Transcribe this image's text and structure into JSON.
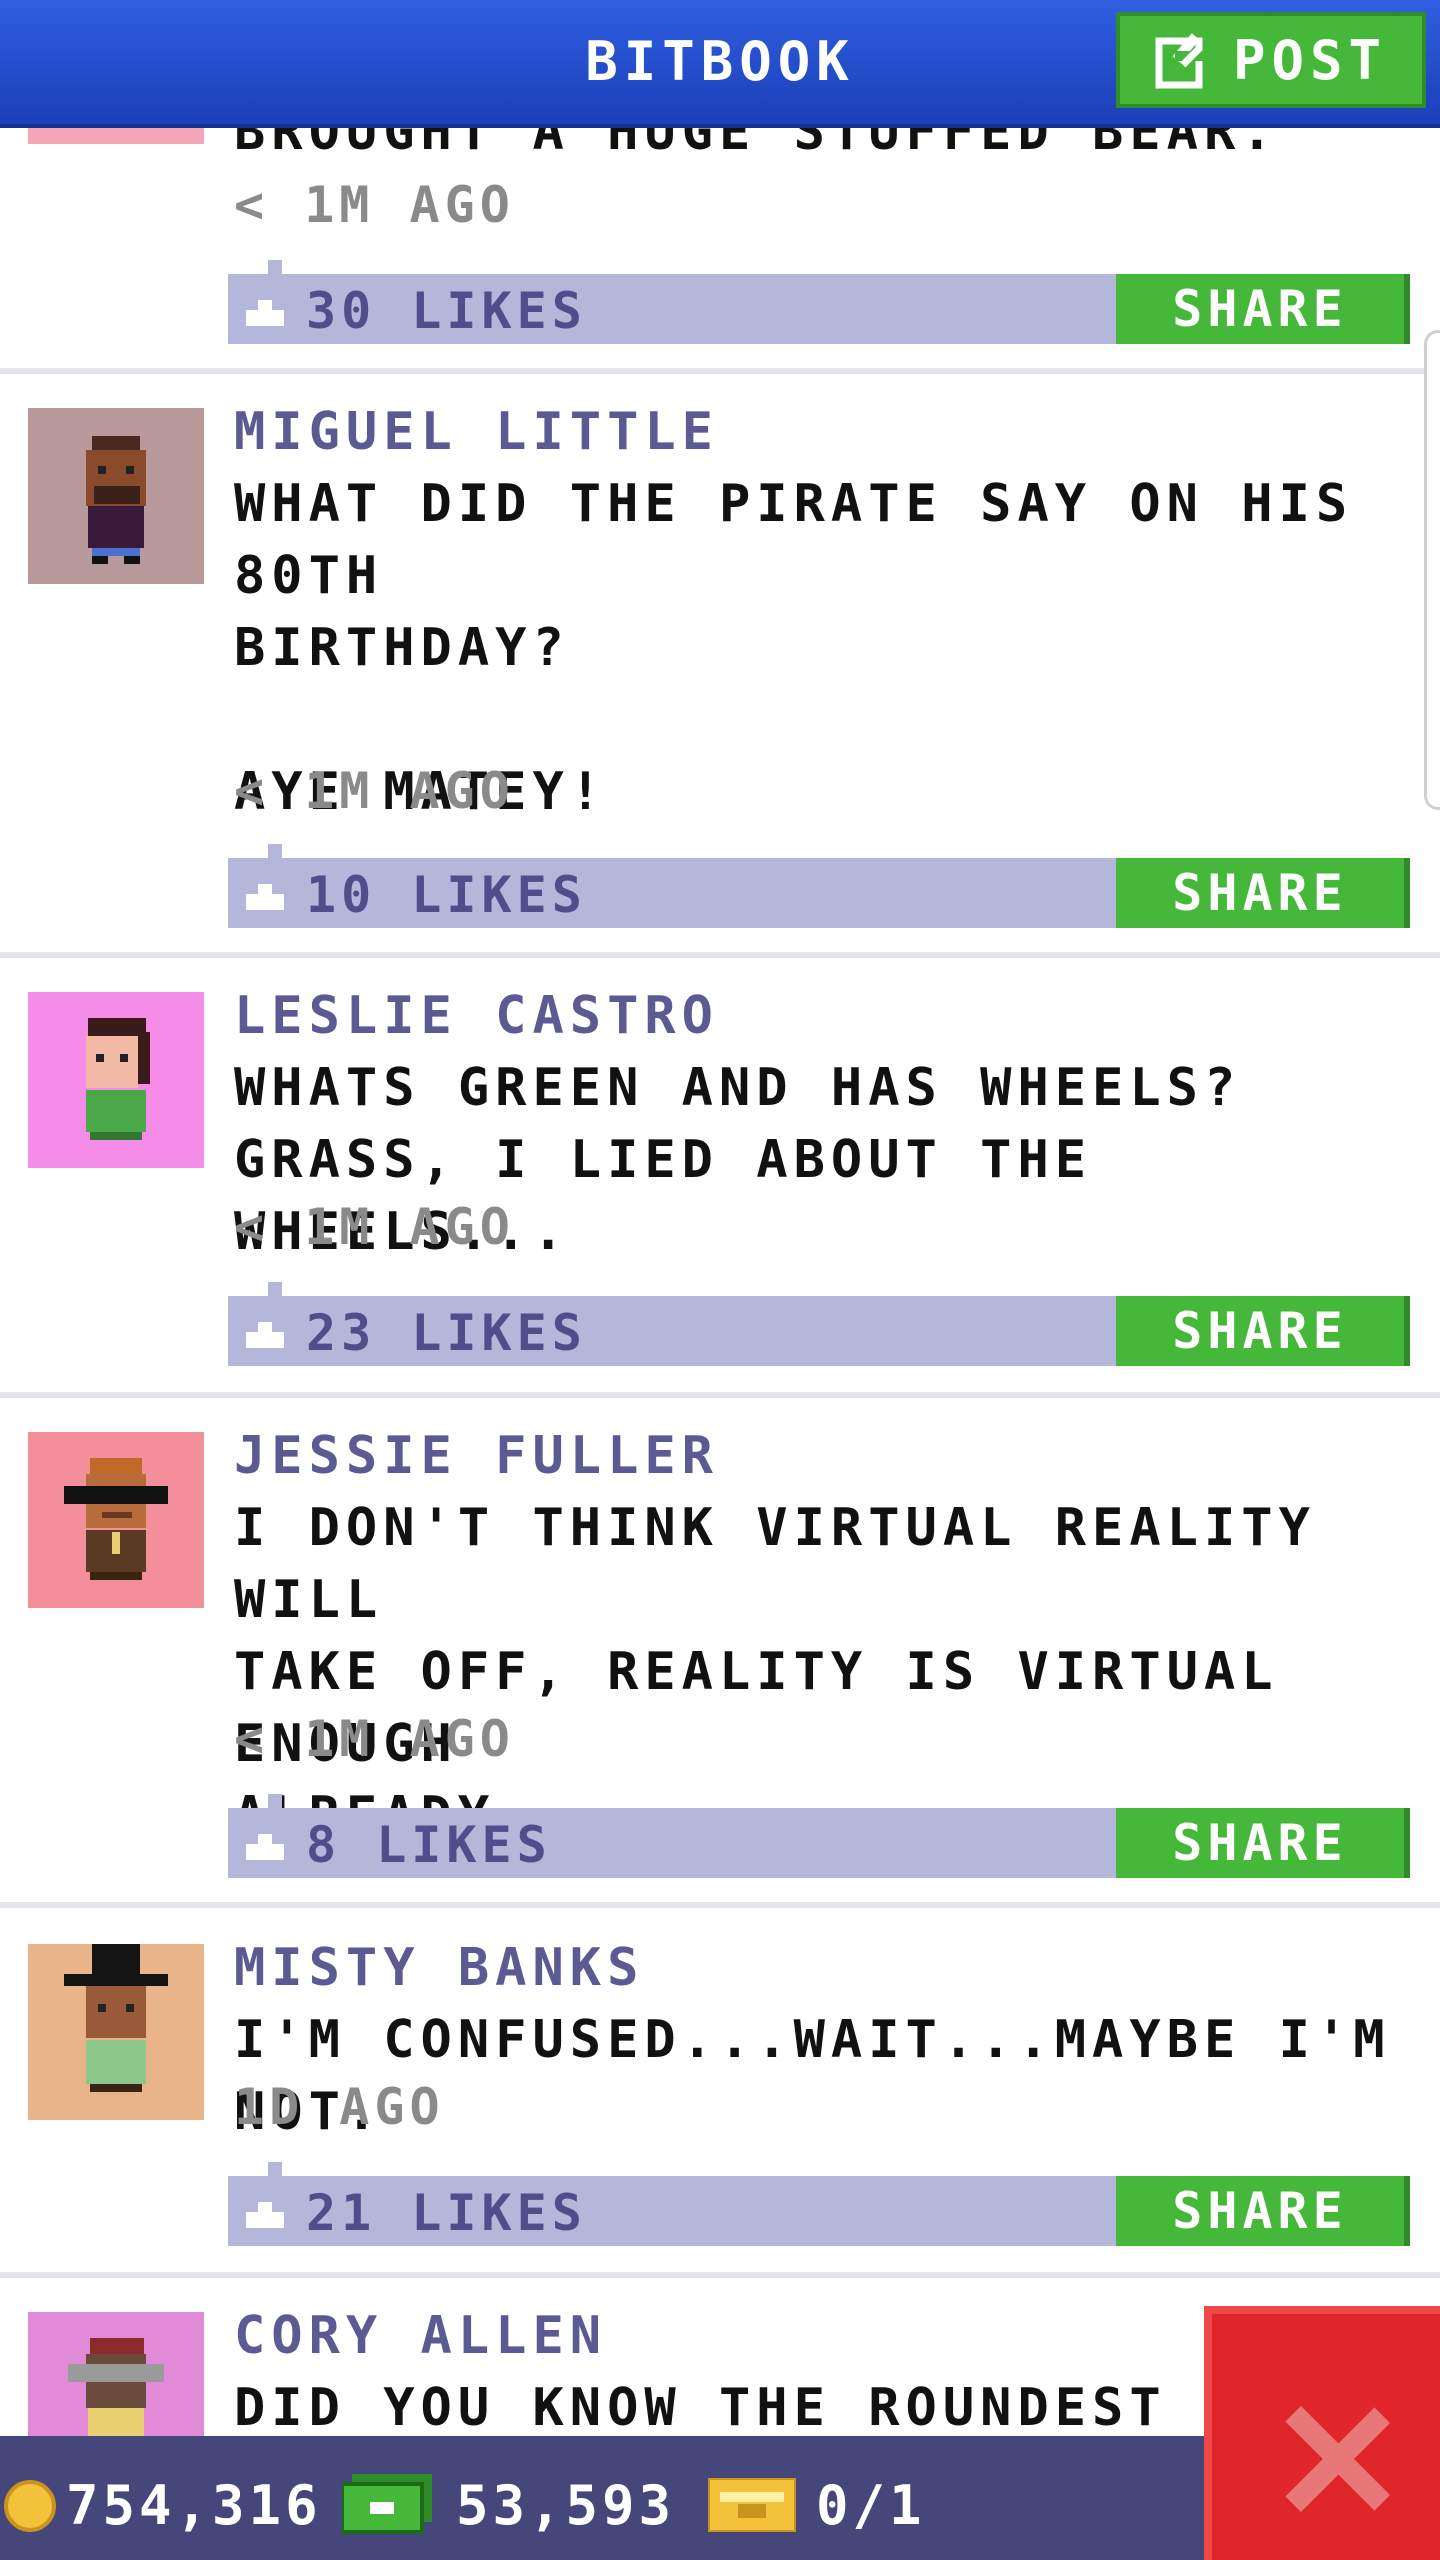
{
  "app": {
    "title": "BITBOOK",
    "post_label": "POST"
  },
  "posts": [
    {
      "author": "",
      "text": "BROUGHT A HUGE STUFFED BEAR.",
      "time": "< 1M AGO",
      "likes": "30 LIKES",
      "share": "SHARE",
      "avatar_color": "#f4a6b9"
    },
    {
      "author": "MIGUEL LITTLE",
      "text": "WHAT DID THE PIRATE SAY ON HIS 80TH\nBIRTHDAY?\n\nAYE MATEY!",
      "time": "< 1M AGO",
      "likes": "10 LIKES",
      "share": "SHARE",
      "avatar_color": "#b99a9a"
    },
    {
      "author": "LESLIE CASTRO",
      "text": "WHATS GREEN AND HAS WHEELS?\nGRASS, I LIED ABOUT THE WHEELS...",
      "time": "< 1M AGO",
      "likes": "23 LIKES",
      "share": "SHARE",
      "avatar_color": "#f58ce8"
    },
    {
      "author": "JESSIE FULLER",
      "text": "I DON'T THINK VIRTUAL REALITY WILL\nTAKE OFF, REALITY IS VIRTUAL ENOUGH\nALREADY.",
      "time": "< 1M AGO",
      "likes": "8 LIKES",
      "share": "SHARE",
      "avatar_color": "#f28f9a"
    },
    {
      "author": "MISTY BANKS",
      "text": "I'M CONFUSED...WAIT...MAYBE I'M NOT.",
      "time": "1D AGO",
      "likes": "21 LIKES",
      "share": "SHARE",
      "avatar_color": "#e9b48a"
    },
    {
      "author": "CORY ALLEN",
      "text": "DID YOU KNOW THE ROUNDEST K",
      "time": "",
      "likes": "",
      "share": "",
      "avatar_color": "#e08ad8"
    }
  ],
  "footer": {
    "coins": "754,316",
    "cash": "53,593",
    "tickets": "0/1"
  },
  "colors": {
    "header": "#1f48c8",
    "share": "#45b83a",
    "likebar": "#b4b7da",
    "footer": "#45477a",
    "close": "#e0262b"
  }
}
